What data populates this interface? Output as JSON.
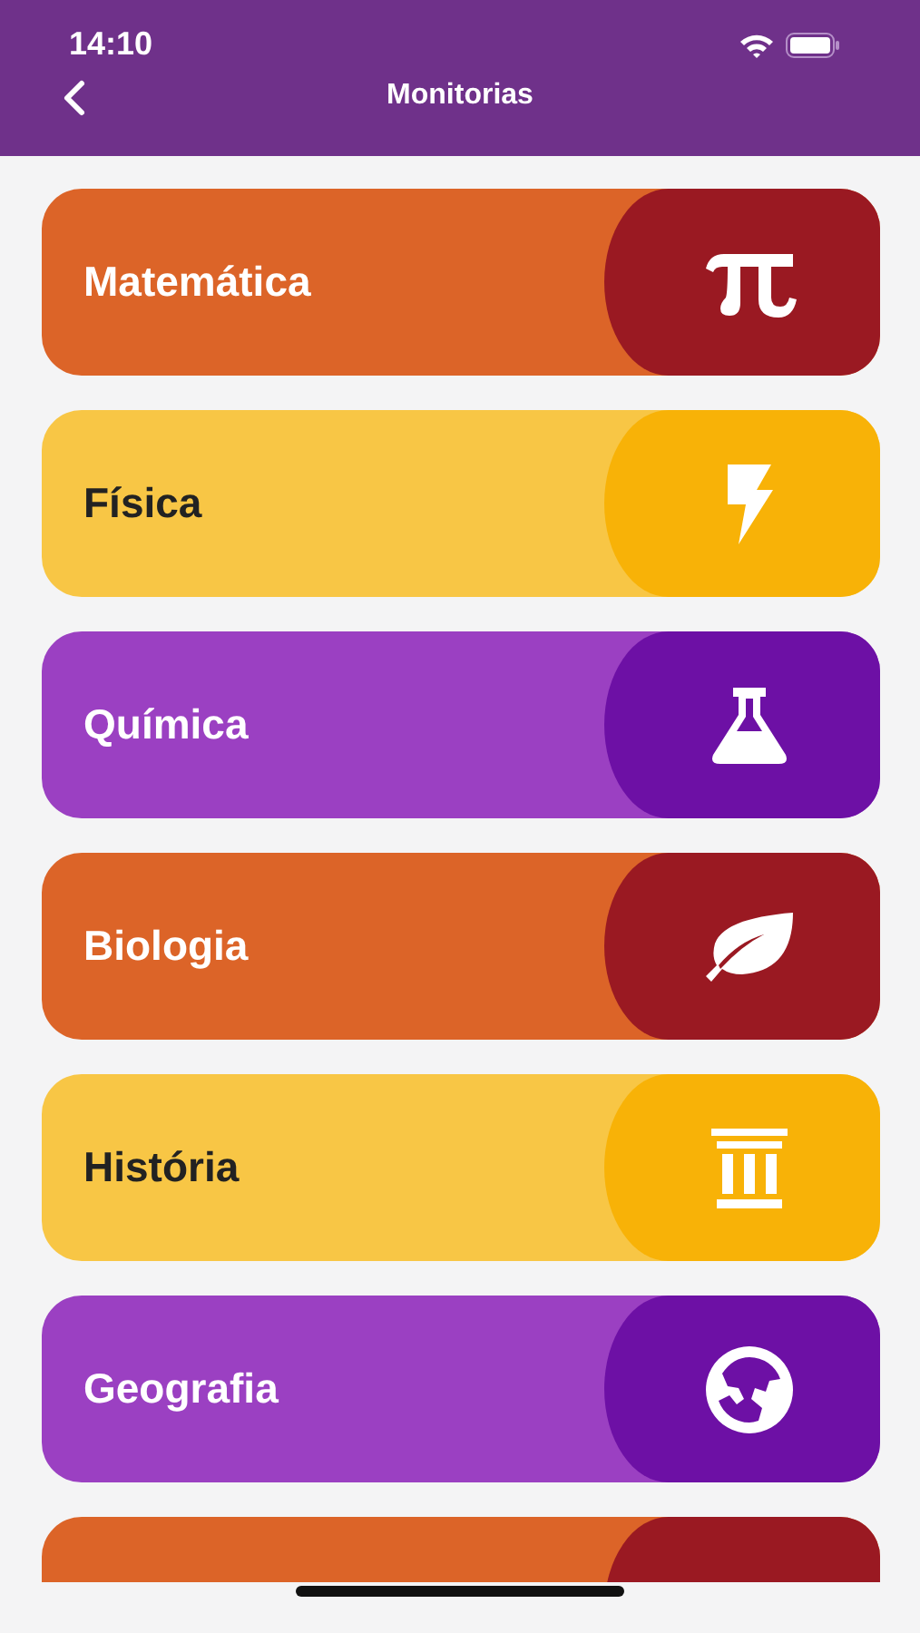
{
  "status_bar": {
    "time": "14:10"
  },
  "nav": {
    "title": "Monitorias"
  },
  "subjects": [
    {
      "label": "Matemática",
      "color": "#dc6428",
      "kind": "pi"
    },
    {
      "label": "Física",
      "color": "#f8c645",
      "kind": "bolt"
    },
    {
      "label": "Química",
      "color": "#9b40c2",
      "kind": "flask"
    },
    {
      "label": "Biologia",
      "color": "#dc6428",
      "kind": "leaf"
    },
    {
      "label": "História",
      "color": "#f8c645",
      "kind": "column"
    },
    {
      "label": "Geografia",
      "color": "#9b40c2",
      "kind": "globe"
    },
    {
      "color": "#dc6428",
      "kind": "none"
    }
  ]
}
